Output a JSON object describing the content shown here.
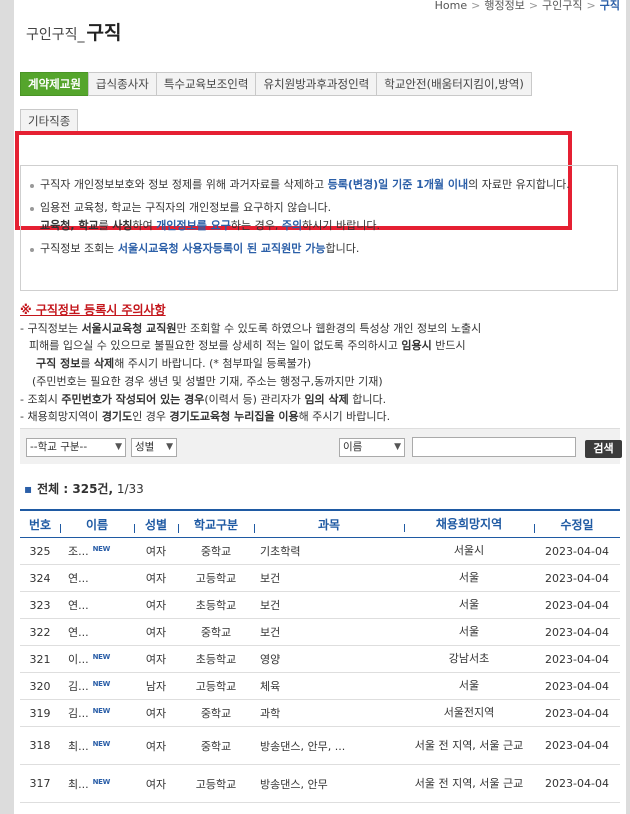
{
  "breadcrumb": {
    "home": "Home",
    "sep": ">",
    "level1": "행정정보",
    "level2": "구인구직",
    "current": "구직"
  },
  "title": {
    "sub": "구인구직_",
    "main": "구직"
  },
  "tabs": [
    {
      "label": "계약제교원",
      "active": true
    },
    {
      "label": "급식종사자"
    },
    {
      "label": "특수교육보조인력"
    },
    {
      "label": "유치원방과후과정인력"
    },
    {
      "label": "학교안전(배움터지킴이,방역)"
    },
    {
      "label": "기타직종"
    }
  ],
  "notice": {
    "i1": {
      "a": "구직자 개인정보보호와 정보 정제를 위해 과거자료를 삭제하고 ",
      "b": "등록(변경)일 기준 1개월 이내",
      "c": "의 자료만 유지합니다."
    },
    "i2": {
      "a": "임용전 교육청, 학교는 구직자의 개인정보를 요구하지 않습니다.",
      "b": "교육청, 학교",
      "c": "를 ",
      "d": "사칭",
      "e": "하여 ",
      "f": "개인정보를 요구",
      "g": "하는 경우, ",
      "h": "주의",
      "i": "하시기 바랍니다."
    },
    "i3": {
      "a": "구직정보 조회는 ",
      "b": "서울시교육청 사용자등록이 된 교직원만 가능",
      "c": "합니다."
    }
  },
  "caution": {
    "title": "※ 구직정보 등록시 주의사항",
    "l1": {
      "a": "- 구직정보는 ",
      "b": "서울시교육청 교직원",
      "c": "만 조회할 수 있도록 하였으나 웹환경의 특성상 개인 정보의 노출시"
    },
    "l2": {
      "a": "   피해를 입으실 수 있으므로 불필요한 정보를 상세히 적는 일이 없도록 주의하시고 ",
      "b": "임용시",
      "c": " 반드시"
    },
    "l3": {
      "a": "구직 정보",
      "b": "를 ",
      "c": "삭제",
      "d": "해 주시기 바랍니다. (* 첨부파일 등록불가)"
    },
    "l4": "(주민번호는 필요한 경우 생년 및 성별만 기재, 주소는 행정구,동까지만 기재)",
    "l5": {
      "a": "- 조회시 ",
      "b": "주민번호가 작성되어 있는 경우",
      "c": "(이력서 등) 관리자가 ",
      "d": "임의 삭제",
      "e": " 합니다."
    },
    "l6": {
      "a": "- 채용희망지역이 ",
      "b": "경기도",
      "c": "인 경우 ",
      "d": "경기도교육청 누리집을 이용",
      "e": "해 주시기 바랍니다."
    }
  },
  "search": {
    "school_select": "--학교 구분--",
    "gender_select": "성별",
    "field_select": "이름",
    "input_value": "",
    "button": "검색"
  },
  "total": {
    "label": "전체 : 325건,",
    "page": "1/33"
  },
  "table": {
    "headers": [
      "번호",
      "이름",
      "성별",
      "학교구분",
      "과목",
      "채용희망지역",
      "수정일"
    ],
    "rows": [
      {
        "no": "325",
        "name": "조...",
        "new": "NEW",
        "gender": "여자",
        "school": "중학교",
        "subject": "기초학력",
        "region": "서울시",
        "date": "2023-04-04"
      },
      {
        "no": "324",
        "name": "연...",
        "new": "",
        "gender": "여자",
        "school": "고등학교",
        "subject": "보건",
        "region": "서울",
        "date": "2023-04-04"
      },
      {
        "no": "323",
        "name": "연...",
        "new": "",
        "gender": "여자",
        "school": "초등학교",
        "subject": "보건",
        "region": "서울",
        "date": "2023-04-04"
      },
      {
        "no": "322",
        "name": "연...",
        "new": "",
        "gender": "여자",
        "school": "중학교",
        "subject": "보건",
        "region": "서울",
        "date": "2023-04-04"
      },
      {
        "no": "321",
        "name": "이...",
        "new": "NEW",
        "gender": "여자",
        "school": "초등학교",
        "subject": "영양",
        "region": "강남서초",
        "date": "2023-04-04"
      },
      {
        "no": "320",
        "name": "김...",
        "new": "NEW",
        "gender": "남자",
        "school": "고등학교",
        "subject": "체육",
        "region": "서울",
        "date": "2023-04-04"
      },
      {
        "no": "319",
        "name": "김...",
        "new": "NEW",
        "gender": "여자",
        "school": "중학교",
        "subject": "과학",
        "region": "서울전지역",
        "date": "2023-04-04"
      },
      {
        "no": "318",
        "name": "최...",
        "new": "NEW",
        "gender": "여자",
        "school": "중학교",
        "subject": "방송댄스, 안무, ...",
        "region": "서울 전 지역, 서울 근교",
        "date": "2023-04-04"
      },
      {
        "no": "317",
        "name": "최...",
        "new": "NEW",
        "gender": "여자",
        "school": "고등학교",
        "subject": "방송댄스, 안무",
        "region": "서울 전 지역, 서울 근교",
        "date": "2023-04-04"
      }
    ]
  },
  "colors": {
    "active_tab": "#55a52c",
    "highlight_frame": "#e52032",
    "header_blue": "#1f5aa3",
    "caution_red": "#c4161c"
  }
}
